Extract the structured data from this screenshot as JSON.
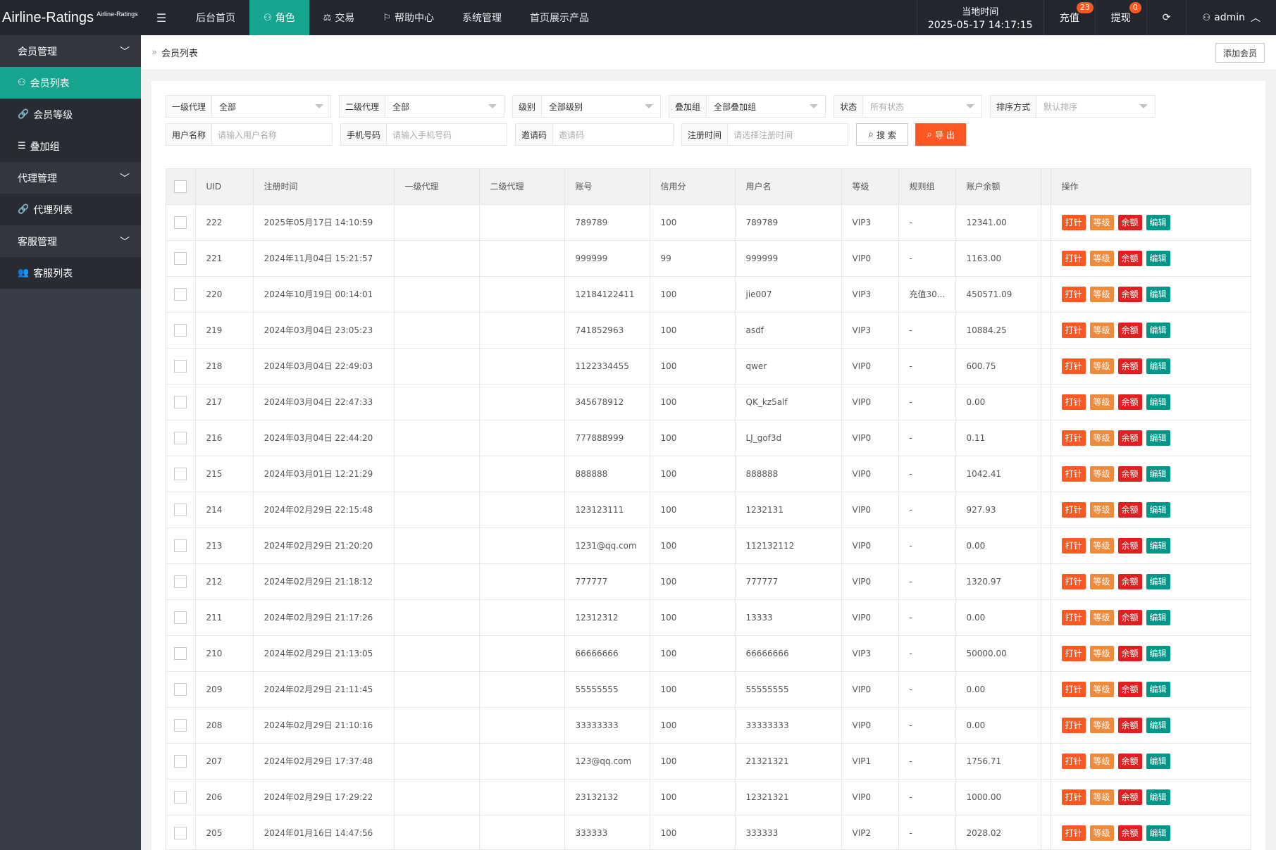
{
  "brand": {
    "main": "Airline-Ratings",
    "sub": "Airline-Ratings"
  },
  "topnav": [
    {
      "label": "后台首页",
      "icon": "",
      "active": false
    },
    {
      "label": "角色",
      "icon": "user-icon",
      "active": true
    },
    {
      "label": "交易",
      "icon": "scale-icon",
      "active": false
    },
    {
      "label": "帮助中心",
      "icon": "flag-icon",
      "active": false
    },
    {
      "label": "系统管理",
      "icon": "",
      "active": false
    },
    {
      "label": "首页展示产品",
      "icon": "",
      "active": false
    }
  ],
  "header": {
    "clock_label": "当地时间",
    "clock_value": "2025-05-17 14:17:15",
    "recharge_label": "充值",
    "recharge_count": "23",
    "withdraw_label": "提现",
    "withdraw_count": "0",
    "user_label": "admin"
  },
  "sidebar": {
    "groups": [
      {
        "label": "会员管理",
        "items": [
          {
            "label": "会员列表",
            "icon": "user-icon",
            "active": true
          },
          {
            "label": "会员等级",
            "icon": "link-icon",
            "active": false
          },
          {
            "label": "叠加组",
            "icon": "list-icon",
            "active": false
          }
        ]
      },
      {
        "label": "代理管理",
        "items": [
          {
            "label": "代理列表",
            "icon": "link-icon",
            "active": false
          }
        ]
      },
      {
        "label": "客服管理",
        "items": [
          {
            "label": "客服列表",
            "icon": "users-icon",
            "active": false
          }
        ]
      }
    ]
  },
  "breadcrumb": {
    "current": "会员列表"
  },
  "add_button": "添加会员",
  "filters": {
    "selects": [
      {
        "label": "一级代理",
        "value": "全部",
        "placeholder": false
      },
      {
        "label": "二级代理",
        "value": "全部",
        "placeholder": false
      },
      {
        "label": "级别",
        "value": "全部级别",
        "placeholder": false
      },
      {
        "label": "叠加组",
        "value": "全部叠加组",
        "placeholder": false
      },
      {
        "label": "状态",
        "value": "所有状态",
        "placeholder": true
      },
      {
        "label": "排序方式",
        "value": "默认排序",
        "placeholder": true
      }
    ],
    "inputs": [
      {
        "label": "用户名称",
        "placeholder": "请输入用户名称"
      },
      {
        "label": "手机号码",
        "placeholder": "请输入手机号码"
      },
      {
        "label": "邀请码",
        "placeholder": "邀请码"
      },
      {
        "label": "注册时间",
        "placeholder": "请选择注册时间"
      }
    ],
    "search_label": "搜 索",
    "export_label": "导 出"
  },
  "table": {
    "columns": [
      "UID",
      "注册时间",
      "一级代理",
      "二级代理",
      "账号",
      "信用分",
      "用户名",
      "等级",
      "规则组",
      "账户余额",
      "",
      "操作"
    ],
    "actions": {
      "beat": "打针",
      "level": "等级",
      "balance": "余额",
      "edit": "编辑"
    },
    "rows": [
      [
        "222",
        "2025年05月17日 14:10:59",
        "",
        "",
        "789789",
        "100",
        "789789",
        "VIP3",
        "-",
        "12341.00"
      ],
      [
        "221",
        "2024年11月04日 15:21:57",
        "",
        "",
        "999999",
        "99",
        "999999",
        "VIP0",
        "-",
        "1163.00"
      ],
      [
        "220",
        "2024年10月19日 00:14:01",
        "",
        "",
        "12184122411",
        "100",
        "jie007",
        "VIP3",
        "充值30...",
        "450571.09"
      ],
      [
        "219",
        "2024年03月04日 23:05:23",
        "",
        "",
        "741852963",
        "100",
        "asdf",
        "VIP3",
        "-",
        "10884.25"
      ],
      [
        "218",
        "2024年03月04日 22:49:03",
        "",
        "",
        "1122334455",
        "100",
        "qwer",
        "VIP0",
        "-",
        "600.75"
      ],
      [
        "217",
        "2024年03月04日 22:47:33",
        "",
        "",
        "345678912",
        "100",
        "QK_kz5alf",
        "VIP0",
        "-",
        "0.00"
      ],
      [
        "216",
        "2024年03月04日 22:44:20",
        "",
        "",
        "777888999",
        "100",
        "LJ_gof3d",
        "VIP0",
        "-",
        "0.11"
      ],
      [
        "215",
        "2024年03月01日 12:21:29",
        "",
        "",
        "888888",
        "100",
        "888888",
        "VIP0",
        "-",
        "1042.41"
      ],
      [
        "214",
        "2024年02月29日 22:15:48",
        "",
        "",
        "123123111",
        "100",
        "1232131",
        "VIP0",
        "-",
        "927.93"
      ],
      [
        "213",
        "2024年02月29日 21:20:20",
        "",
        "",
        "1231@qq.com",
        "100",
        "112132112",
        "VIP0",
        "-",
        "0.00"
      ],
      [
        "212",
        "2024年02月29日 21:18:12",
        "",
        "",
        "777777",
        "100",
        "777777",
        "VIP0",
        "-",
        "1320.97"
      ],
      [
        "211",
        "2024年02月29日 21:17:26",
        "",
        "",
        "12312312",
        "100",
        "13333",
        "VIP0",
        "-",
        "0.00"
      ],
      [
        "210",
        "2024年02月29日 21:13:05",
        "",
        "",
        "66666666",
        "100",
        "66666666",
        "VIP3",
        "-",
        "50000.00"
      ],
      [
        "209",
        "2024年02月29日 21:11:45",
        "",
        "",
        "55555555",
        "100",
        "55555555",
        "VIP0",
        "-",
        "0.00"
      ],
      [
        "208",
        "2024年02月29日 21:10:16",
        "",
        "",
        "33333333",
        "100",
        "33333333",
        "VIP0",
        "-",
        "0.00"
      ],
      [
        "207",
        "2024年02月29日 17:37:48",
        "",
        "",
        "123@qq.com",
        "100",
        "21321321",
        "VIP1",
        "-",
        "1756.71"
      ],
      [
        "206",
        "2024年02月29日 17:29:22",
        "",
        "",
        "23132132",
        "100",
        "12321321",
        "VIP0",
        "-",
        "1000.00"
      ],
      [
        "205",
        "2024年01月16日 14:47:56",
        "",
        "",
        "333333",
        "100",
        "333333",
        "VIP2",
        "-",
        "2028.02"
      ]
    ]
  },
  "colors": {
    "accent": "#16a68f",
    "danger": "#ff5722",
    "sidebar": "#393d49",
    "topbar": "#23262e"
  }
}
